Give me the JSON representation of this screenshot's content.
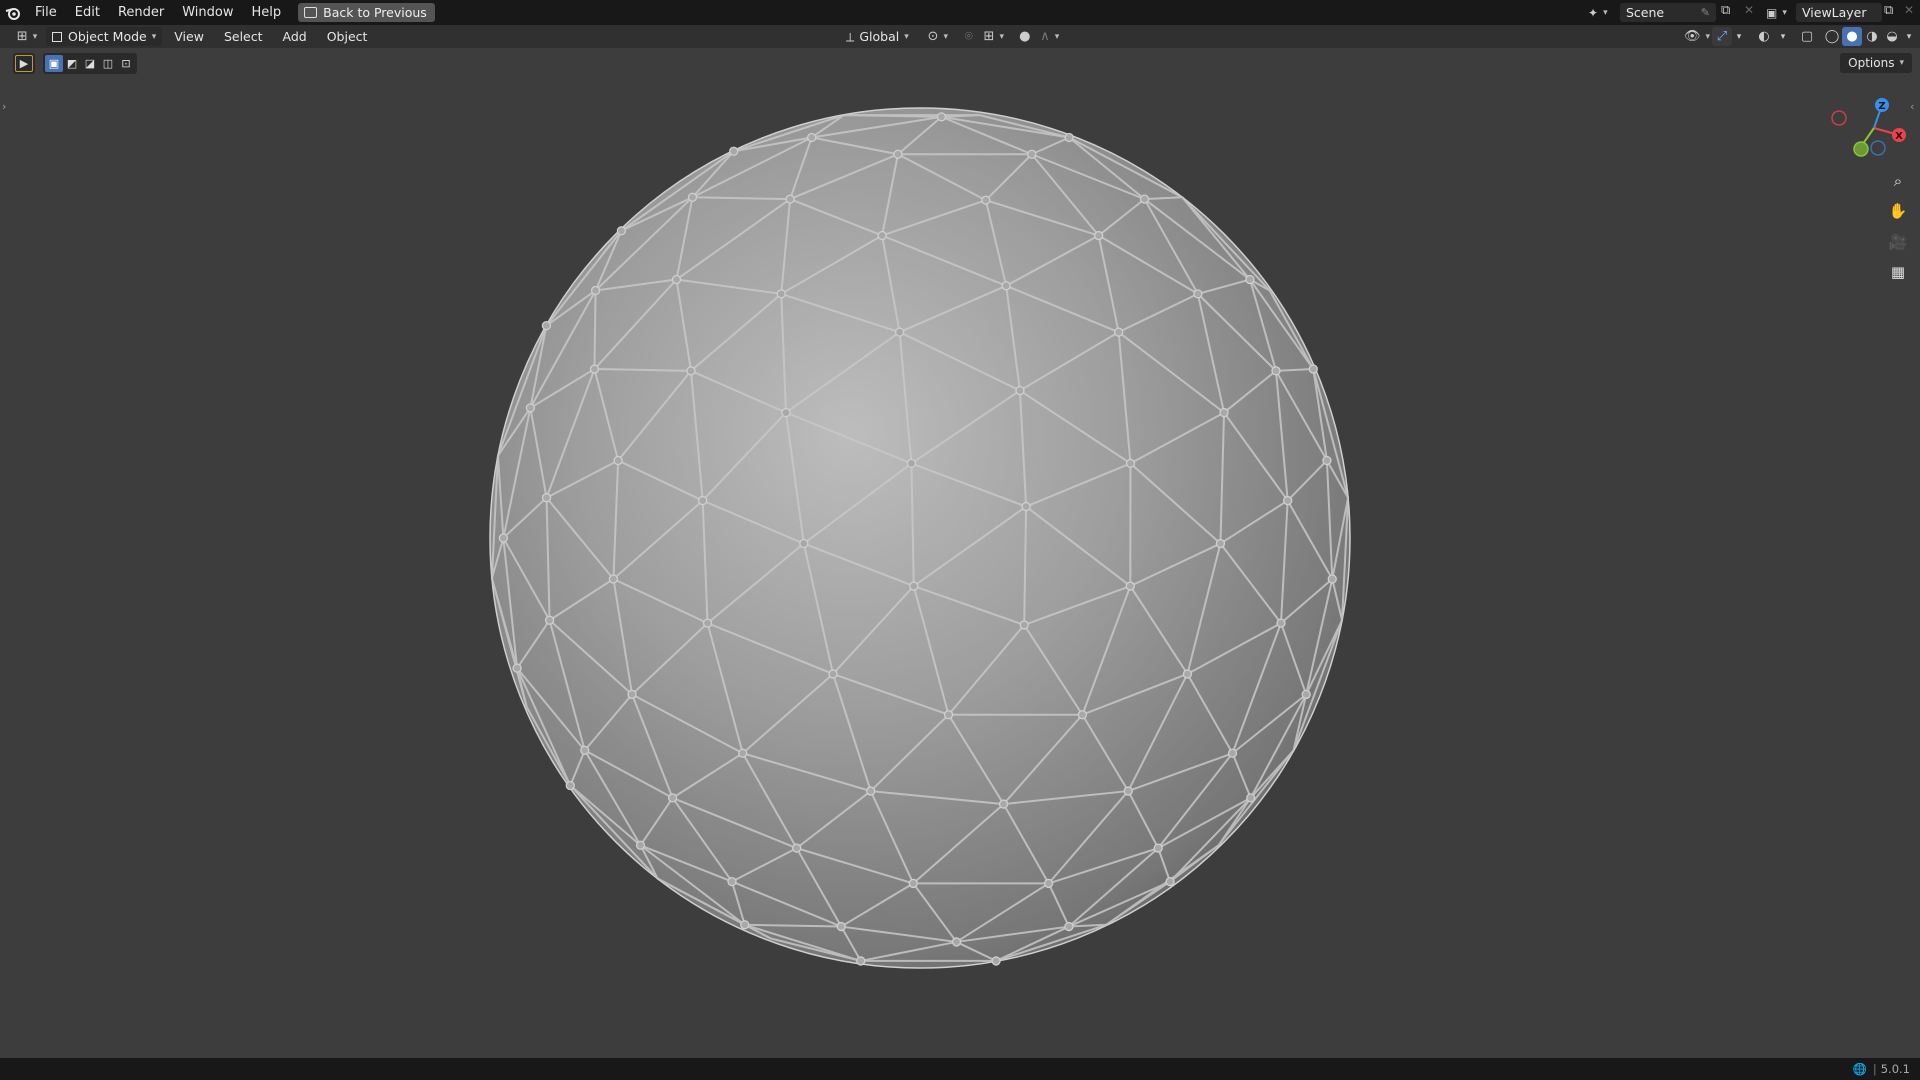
{
  "app": {
    "menu": [
      "File",
      "Edit",
      "Render",
      "Window",
      "Help"
    ],
    "back_button": "Back to Previous",
    "scene": "Scene",
    "view_layer": "ViewLayer"
  },
  "header": {
    "mode": "Object Mode",
    "menus": [
      "View",
      "Select",
      "Add",
      "Object"
    ],
    "orientation": "Global",
    "options": "Options"
  },
  "gizmo": {
    "axes": [
      "Z",
      "X"
    ],
    "colors": {
      "x": "#e8434f",
      "y": "#8ac43c",
      "z": "#3b8fe6"
    }
  },
  "status": {
    "version": "5.0.1"
  },
  "colors": {
    "viewport_bg": "#3d3d3d",
    "accent": "#4772b3"
  },
  "icons": {
    "blender_logo": "blender-icon",
    "zoom": "zoom-icon",
    "pan": "hand-icon",
    "camera": "camera-icon",
    "grid": "grid-icon"
  }
}
